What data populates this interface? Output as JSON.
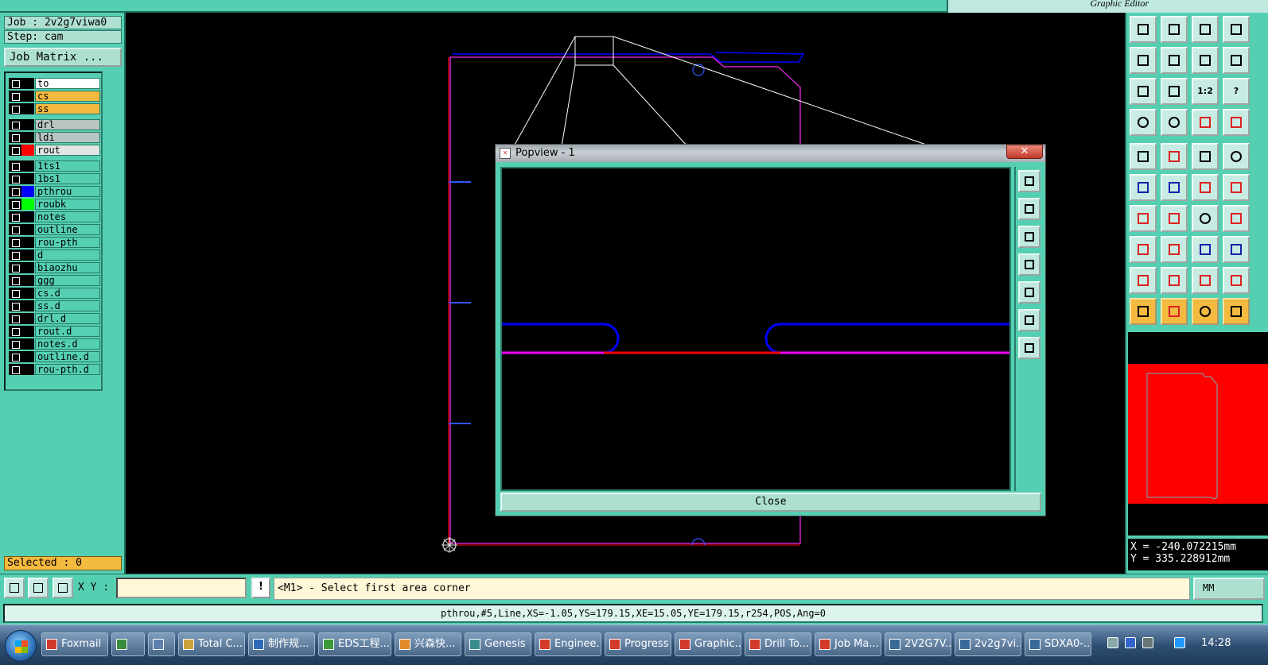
{
  "app": {
    "window_title": "Graphic Editor"
  },
  "left_panel": {
    "job_label": "Job : 2v2g7viwa0",
    "step_label": "Step: cam",
    "job_matrix_button": "Job Matrix ...",
    "layers": [
      {
        "name": "to",
        "color": "#ffffff",
        "swatch": ""
      },
      {
        "name": "cs",
        "color": "#f4b93f",
        "swatch": ""
      },
      {
        "name": "ss",
        "color": "#f4b93f",
        "swatch": ""
      },
      {
        "name": "drl",
        "color": "#b9c5c2",
        "swatch": ""
      },
      {
        "name": "ldi",
        "color": "#b9c5c2",
        "swatch": ""
      },
      {
        "name": "rout",
        "color": "#e0e6e4",
        "swatch": "#ff0000",
        "mark": "⊞"
      },
      {
        "name": "1ts1",
        "color": "#55cfb2",
        "swatch": ""
      },
      {
        "name": "1bs1",
        "color": "#55cfb2",
        "swatch": ""
      },
      {
        "name": "pthrou",
        "color": "#55cfb2",
        "swatch": "#0000ff"
      },
      {
        "name": "roubk",
        "color": "#55cfb2",
        "swatch": "#00ff00"
      },
      {
        "name": "notes",
        "color": "#55cfb2",
        "swatch": ""
      },
      {
        "name": "outline",
        "color": "#55cfb2",
        "swatch": ""
      },
      {
        "name": "rou-pth",
        "color": "#55cfb2",
        "swatch": ""
      },
      {
        "name": "d",
        "color": "#55cfb2",
        "swatch": ""
      },
      {
        "name": "biaozhu",
        "color": "#55cfb2",
        "swatch": ""
      },
      {
        "name": "ggg",
        "color": "#55cfb2",
        "swatch": "",
        "mark": "✐"
      },
      {
        "name": "cs.d",
        "color": "#55cfb2",
        "swatch": ""
      },
      {
        "name": "ss.d",
        "color": "#55cfb2",
        "swatch": ""
      },
      {
        "name": "drl.d",
        "color": "#55cfb2",
        "swatch": ""
      },
      {
        "name": "rout.d",
        "color": "#55cfb2",
        "swatch": ""
      },
      {
        "name": "notes.d",
        "color": "#55cfb2",
        "swatch": ""
      },
      {
        "name": "outline.d",
        "color": "#55cfb2",
        "swatch": ""
      },
      {
        "name": "rou-pth.d",
        "color": "#55cfb2",
        "swatch": ""
      }
    ],
    "selected_label": "Selected : 0"
  },
  "popview": {
    "title": "Popview - 1",
    "close_x": "✕",
    "close_button": "Close",
    "side_buttons": [
      "zoom-window-icon",
      "pan-up-icon",
      "pan-down-icon",
      "pan-left-icon",
      "pan-right-icon",
      "zoom-fit-icon",
      "zoom-home-icon"
    ]
  },
  "right_panel": {
    "ratio_button": "1:2",
    "help_button": "?",
    "coords": {
      "x": "X = -240.072215mm",
      "y": "Y = 335.228912mm"
    }
  },
  "command": {
    "xy_label": "X Y :",
    "xy_value": "",
    "bang_label": "!",
    "prompt": "<M1> - Select first area corner",
    "unit": "MM"
  },
  "status": {
    "text": "pthrou,#5,Line,XS=-1.05,YS=179.15,XE=15.05,YE=179.15,r254,POS,Ang=0"
  },
  "taskbar": {
    "items": [
      {
        "label": "Foxmail",
        "color": "#d23a2a"
      },
      {
        "label": "",
        "color": "#3a8d3a"
      },
      {
        "label": "",
        "color": "#5e7fb0"
      },
      {
        "label": "Total C...",
        "color": "#c9a23a"
      },
      {
        "label": "制作规...",
        "color": "#2d6bb8"
      },
      {
        "label": "EDS工程...",
        "color": "#3a9a3a"
      },
      {
        "label": "兴森快...",
        "color": "#e08a2a"
      },
      {
        "label": "Genesis",
        "color": "#3a8d8d"
      },
      {
        "label": "Enginee...",
        "color": "#d23a2a"
      },
      {
        "label": "Progress",
        "color": "#d23a2a"
      },
      {
        "label": "Graphic...",
        "color": "#d23a2a"
      },
      {
        "label": "Drill To...",
        "color": "#d23a2a"
      },
      {
        "label": "Job Ma...",
        "color": "#d23a2a"
      },
      {
        "label": "2V2G7V...",
        "color": "#3a6a9a"
      },
      {
        "label": "2v2g7vi...",
        "color": "#3a6a9a"
      },
      {
        "label": "SDXA0-...",
        "color": "#3a6a9a"
      }
    ],
    "clock": "14:28"
  },
  "colors": {
    "panel": "#55cfb2",
    "canvas": "#000000",
    "profile_magenta": "#ff00ff",
    "rout_red": "#ff0000",
    "pthrou_blue": "#0000ff"
  }
}
